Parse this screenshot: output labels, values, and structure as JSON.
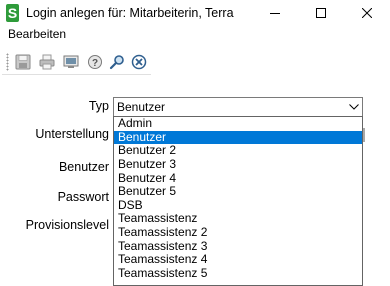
{
  "window": {
    "title": "Login anlegen für: Mitarbeiterin, Terra",
    "logo_letter": "S"
  },
  "menu": {
    "items": [
      "Bearbeiten"
    ]
  },
  "toolbar": {
    "icons": [
      "save-icon",
      "print-icon",
      "monitor-icon",
      "help-icon",
      "search-icon",
      "close-circle-icon"
    ]
  },
  "form": {
    "labels": {
      "typ": "Typ",
      "unterstellung": "Unterstellung",
      "benutzer": "Benutzer",
      "passwort": "Passwort",
      "provisionslevel": "Provisionslevel"
    },
    "typ_select": {
      "value": "Benutzer",
      "options": [
        "Admin",
        "Benutzer",
        "Benutzer 2",
        "Benutzer 3",
        "Benutzer 4",
        "Benutzer 5",
        "DSB",
        "Teamassistenz",
        "Teamassistenz 2",
        "Teamassistenz 3",
        "Teamassistenz 4",
        "Teamassistenz 5"
      ],
      "highlighted": "Benutzer"
    }
  },
  "colors": {
    "selection": "#0078d7",
    "logo": "#2e9b3a"
  }
}
